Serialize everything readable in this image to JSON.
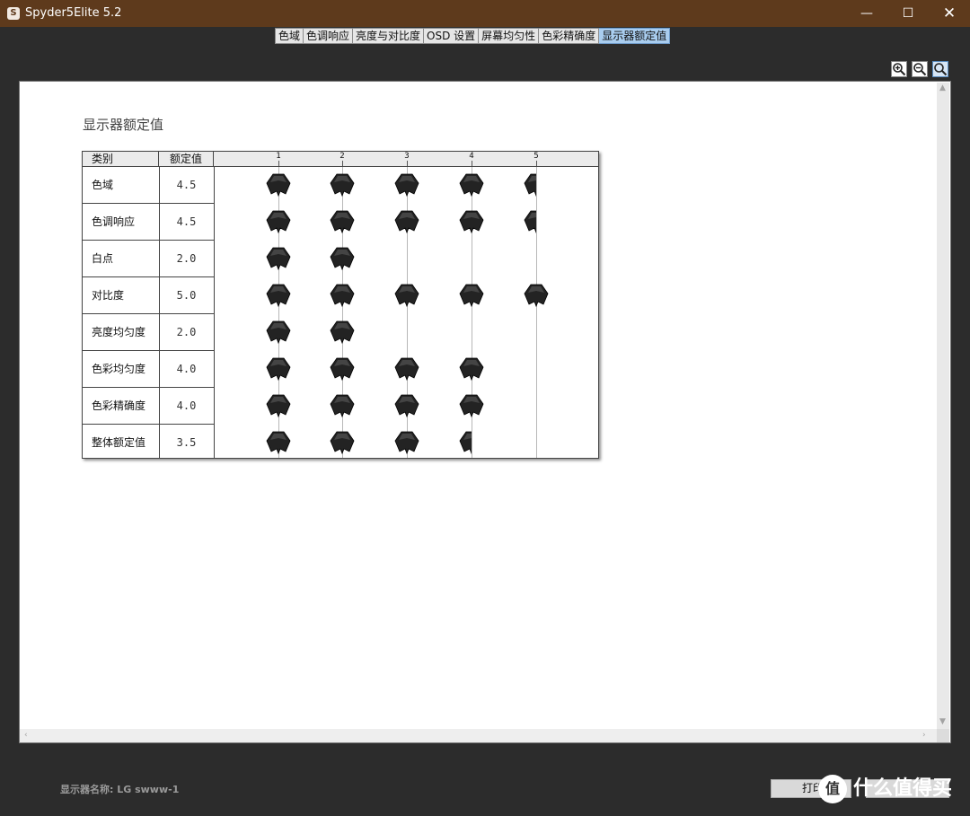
{
  "window": {
    "icon_label": "S",
    "title": "Spyder5Elite 5.2",
    "icons": [
      "minimize-icon",
      "maximize-icon",
      "close-icon"
    ]
  },
  "tabs": [
    {
      "label": "色域",
      "active": false
    },
    {
      "label": "色调响应",
      "active": false
    },
    {
      "label": "亮度与对比度",
      "active": false
    },
    {
      "label": "OSD 设置",
      "active": false
    },
    {
      "label": "屏幕均匀性",
      "active": false
    },
    {
      "label": "色彩精确度",
      "active": false
    },
    {
      "label": "显示器额定值",
      "active": true
    }
  ],
  "zoom": {
    "icons": [
      "zoom-in-icon",
      "zoom-out-icon",
      "zoom-fit-icon"
    ]
  },
  "report": {
    "title": "显示器额定值",
    "table": {
      "header": {
        "category": "类别",
        "rating": "额定值"
      },
      "scale_ticks": [
        "1",
        "2",
        "3",
        "4",
        "5"
      ],
      "rows": [
        {
          "category": "色域",
          "rating": "4.5",
          "value": 4.5
        },
        {
          "category": "色调响应",
          "rating": "4.5",
          "value": 4.5
        },
        {
          "category": "白点",
          "rating": "2.0",
          "value": 2.0
        },
        {
          "category": "对比度",
          "rating": "5.0",
          "value": 5.0
        },
        {
          "category": "亮度均匀度",
          "rating": "2.0",
          "value": 2.0
        },
        {
          "category": "色彩均匀度",
          "rating": "4.0",
          "value": 4.0
        },
        {
          "category": "色彩精确度",
          "rating": "4.0",
          "value": 4.0
        },
        {
          "category": "整体额定值",
          "rating": "3.5",
          "value": 3.5
        }
      ]
    }
  },
  "footer": {
    "monitor_label": "显示器名称: LG swww-1",
    "print_button": "打印"
  },
  "watermark": {
    "logo": "值",
    "text": "什么值得买"
  },
  "colors": {
    "title_bar": "#5e3a1c",
    "background": "#2c2c2c",
    "active_tab": "#a9cdef",
    "marker": "#222222"
  }
}
